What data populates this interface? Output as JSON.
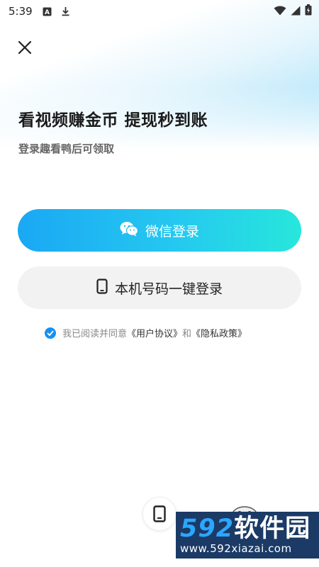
{
  "status_bar": {
    "time": "5:39",
    "left_icons": [
      "a-box-icon",
      "download-icon"
    ],
    "right_icons": [
      "wifi-icon",
      "signal-icon",
      "battery-icon"
    ]
  },
  "header": {
    "title": "看视频赚金币 提现秒到账",
    "subtitle": "登录趣看鸭后可领取"
  },
  "buttons": {
    "wechat_login": "微信登录",
    "phone_login": "本机号码一键登录"
  },
  "agreement": {
    "prefix": "我已阅读并同意",
    "user_agreement": "《用户协议》",
    "and": "和",
    "privacy_policy": "《隐私政策》",
    "checked": true
  },
  "watermark": {
    "number": "592",
    "text": "软件园",
    "url": "www.592xiazai.com"
  },
  "colors": {
    "gradient_start": "#1aa8f4",
    "gradient_end": "#27e7dc",
    "checkbox": "#1890f0",
    "watermark_bg": "#1b3a66"
  }
}
